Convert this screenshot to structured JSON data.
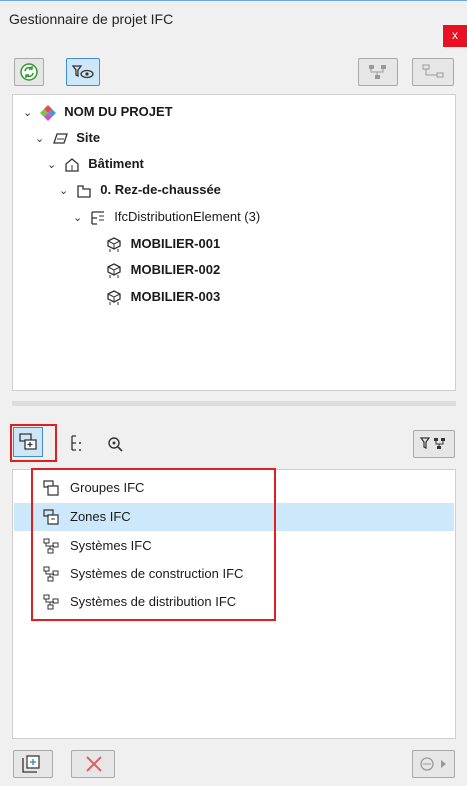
{
  "window": {
    "title": "Gestionnaire de projet IFC",
    "close_glyph": "x"
  },
  "toolbar": {
    "left": [
      {
        "name": "refresh-icon"
      },
      {
        "name": "filter-view-icon"
      }
    ],
    "right": [
      {
        "name": "hierarchy-icon"
      },
      {
        "name": "hierarchy-alt-icon"
      }
    ]
  },
  "tree": [
    {
      "label": "NOM DU PROJET",
      "icon": "project-icon",
      "bold": true
    },
    {
      "label": "Site",
      "icon": "site-icon",
      "bold": true
    },
    {
      "label": "Bâtiment",
      "icon": "building-icon",
      "bold": true
    },
    {
      "label": "0. Rez-de-chaussée",
      "icon": "storey-icon",
      "bold": true
    },
    {
      "label": "IfcDistributionElement (3)",
      "icon": "tree-group-icon",
      "bold": false
    },
    {
      "label": "MOBILIER-001",
      "icon": "element-icon",
      "bold": true
    },
    {
      "label": "MOBILIER-002",
      "icon": "element-icon",
      "bold": true
    },
    {
      "label": "MOBILIER-003",
      "icon": "element-icon",
      "bold": true
    }
  ],
  "mid_toolbar": {
    "items": [
      {
        "name": "groups-mode-icon",
        "active": true
      },
      {
        "name": "tree-structure-icon",
        "active": false
      },
      {
        "name": "search-icon",
        "active": false
      }
    ],
    "right": {
      "name": "filter-hierarchy-icon"
    }
  },
  "list": [
    {
      "label": "Groupes IFC",
      "icon": "groups-ifc-icon",
      "selected": false
    },
    {
      "label": "Zones IFC",
      "icon": "zones-ifc-icon",
      "selected": true
    },
    {
      "label": "Systèmes IFC",
      "icon": "systems-ifc-icon",
      "selected": false
    },
    {
      "label": "Systèmes de construction IFC",
      "icon": "construction-systems-icon",
      "selected": false
    },
    {
      "label": "Systèmes de distribution IFC",
      "icon": "distribution-systems-icon",
      "selected": false
    }
  ],
  "bottom": {
    "add": {
      "name": "add-group-icon"
    },
    "delete": {
      "name": "delete-icon"
    },
    "assign": {
      "name": "assign-icon"
    }
  },
  "colors": {
    "accent": "#3d8fd6",
    "highlight_red": "#e02020",
    "selection": "#cde8fa",
    "close_red": "#e81123"
  }
}
